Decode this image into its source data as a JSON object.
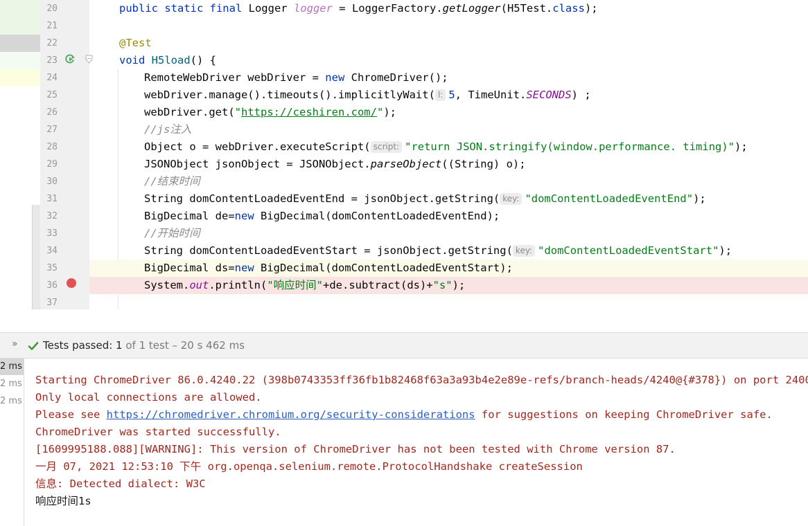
{
  "editor": {
    "line_numbers": [
      "20",
      "21",
      "22",
      "23",
      "24",
      "25",
      "26",
      "27",
      "28",
      "29",
      "30",
      "31",
      "32",
      "33",
      "34",
      "35",
      "36",
      "37"
    ],
    "line20": {
      "kw": "public static final ",
      "type": "Logger ",
      "var": "logger",
      "rest1": " = LoggerFactory.",
      "method": "getLogger",
      "rest2": "(H5Test.",
      "cls": "class",
      "rest3": ");"
    },
    "line22": {
      "annotation": "@Test"
    },
    "line23": {
      "kw": "void ",
      "fn": "H5load",
      "rest": "() {"
    },
    "line24": {
      "a": "RemoteWebDriver webDriver = ",
      "kw": "new",
      "b": " ChromeDriver();"
    },
    "line25": {
      "a": "webDriver.manage().timeouts().implicitlyWait(",
      "hint": "l:",
      "num": "5",
      "b": ", TimeUnit.",
      "field": "SECONDS",
      "c": ") ;"
    },
    "line26": {
      "a": "webDriver.get(",
      "q1": "\"",
      "url": "https://ceshiren.com/",
      "q2": "\"",
      "b": ");"
    },
    "line27": {
      "comment": "//js注入"
    },
    "line28": {
      "a": "Object o = webDriver.executeScript(",
      "hint": "script:",
      "str": "\"return JSON.stringify(window.performance. timing)\"",
      "b": ");"
    },
    "line29": {
      "a": "JSONObject jsonObject = JSONObject.",
      "method": "parseObject",
      "b": "((String) o);"
    },
    "line30": {
      "comment": "//结束时间"
    },
    "line31": {
      "a": "String domContentLoadedEventEnd = jsonObject.getString(",
      "hint": "key:",
      "str": "\"domContentLoadedEventEnd\"",
      "b": ");"
    },
    "line32": {
      "a": "BigDecimal de=",
      "kw": "new",
      "b": " BigDecimal(domContentLoadedEventEnd);"
    },
    "line33": {
      "comment": "//开始时间"
    },
    "line34": {
      "a": "String domContentLoadedEventStart = jsonObject.getString(",
      "hint": "key:",
      "str": "\"domContentLoadedEventStart\"",
      "b": ");"
    },
    "line35": {
      "a": "BigDecimal ds=",
      "kw": "new",
      "b": " BigDecimal(domContentLoadedEventStart);"
    },
    "line36": {
      "a": "System.",
      "field": "out",
      "b": ".println(",
      "str1": "\"响应时间\"",
      "c": "+de.subtract(ds)+",
      "str2": "\"s\"",
      "d": ");"
    }
  },
  "test_bar": {
    "chevron": "»",
    "label": "Tests passed: ",
    "count": "1",
    "rest": " of 1 test – 20 s 462 ms"
  },
  "durations": [
    "2 ms",
    "2 ms",
    "2 ms"
  ],
  "console": {
    "lines": [
      "Starting ChromeDriver 86.0.4240.22 (398b0743353ff36fb1b82468f63a3a93b4e2e89e-refs/branch-heads/4240@{#378}) on port 2400",
      "Only local connections are allowed."
    ],
    "line3_prefix": "Please see ",
    "line3_link": "https://chromedriver.chromium.org/security-considerations",
    "line3_suffix": " for suggestions on keeping ChromeDriver safe.",
    "lines_after": [
      "ChromeDriver was started successfully.",
      "[1609995188.088][WARNING]: This version of ChromeDriver has not been tested with Chrome version 87.",
      "一月 07, 2021 12:53:10 下午 org.openqa.selenium.remote.ProtocolHandshake createSession",
      "信息: Detected dialect: W3C"
    ],
    "output": "响应时间1s"
  },
  "colors": {
    "keyword": "#0033b3",
    "string": "#067d17",
    "annotation": "#9e880d",
    "console_error": "#a0281e",
    "link": "#2b5fbf",
    "breakpoint": "#e35252",
    "pass": "#3c9a3c"
  },
  "icons": [
    "run-test-icon",
    "fold-icon",
    "breakpoint-icon",
    "check-icon",
    "chevron-double-right-icon"
  ]
}
